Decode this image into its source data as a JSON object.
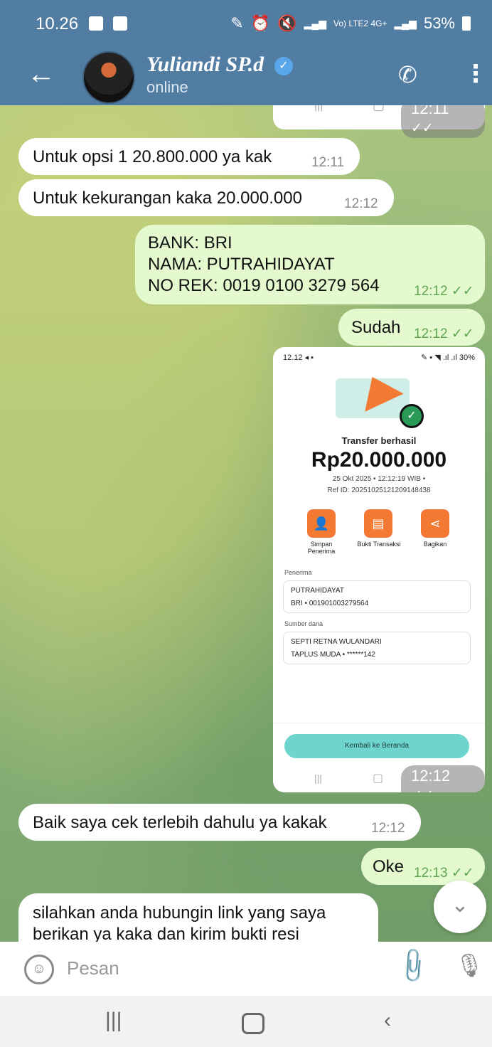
{
  "status": {
    "time": "10.26",
    "battery": "53%",
    "network": "Vo) LTE2 4G+"
  },
  "header": {
    "name": "Yuliandi SP.d",
    "status": "online",
    "back_icon": "arrow-left-icon",
    "call_icon": "phone-icon",
    "more_icon": "kebab-icon"
  },
  "messages": [
    {
      "dir": "out",
      "time": "12:11"
    },
    {
      "dir": "in",
      "text": "Untuk opsi 1 20.800.000 ya kak",
      "time": "12:11"
    },
    {
      "dir": "in",
      "text": "Untuk kekurangan kaka 20.000.000",
      "time": "12:12"
    },
    {
      "dir": "out",
      "lines": [
        "BANK: BRI",
        "NAMA:  PUTRAHIDAYAT",
        "NO REK:  0019 0100 3279 564"
      ],
      "time": "12:12"
    },
    {
      "dir": "out",
      "text": "Sudah",
      "time": "12:12"
    },
    {
      "dir": "out",
      "type": "image",
      "time": "12:12"
    },
    {
      "dir": "in",
      "text": "Baik saya cek terlebih dahulu ya kakak",
      "time": "12:12"
    },
    {
      "dir": "out",
      "text": "Oke",
      "time": "12:13"
    },
    {
      "dir": "in",
      "lines": [
        "silahkan anda hubungin link yang saya",
        "berikan ya kaka dan kirim bukti resi"
      ]
    }
  ],
  "transfer": {
    "status_time": "12.12",
    "status_batt": "30%",
    "title": "Transfer berhasil",
    "amount": "Rp20.000.000",
    "date": "25 Okt 2025 • 12:12:19 WIB •",
    "ref": "Ref ID: 20251025121209148438",
    "actions": [
      "Simpan Penerima",
      "Bukti Transaksi",
      "Bagikan"
    ],
    "penerima_label": "Penerima",
    "penerima_name": "PUTRAHIDAYAT",
    "penerima_acct": "BRI • 001901003279564",
    "sumber_label": "Sumber dana",
    "sumber_name": "SEPTI RETNA WULANDARI",
    "sumber_acct": "TAPLUS MUDA • ******142",
    "button": "Kembali ke Beranda"
  },
  "input": {
    "placeholder": "Pesan"
  }
}
